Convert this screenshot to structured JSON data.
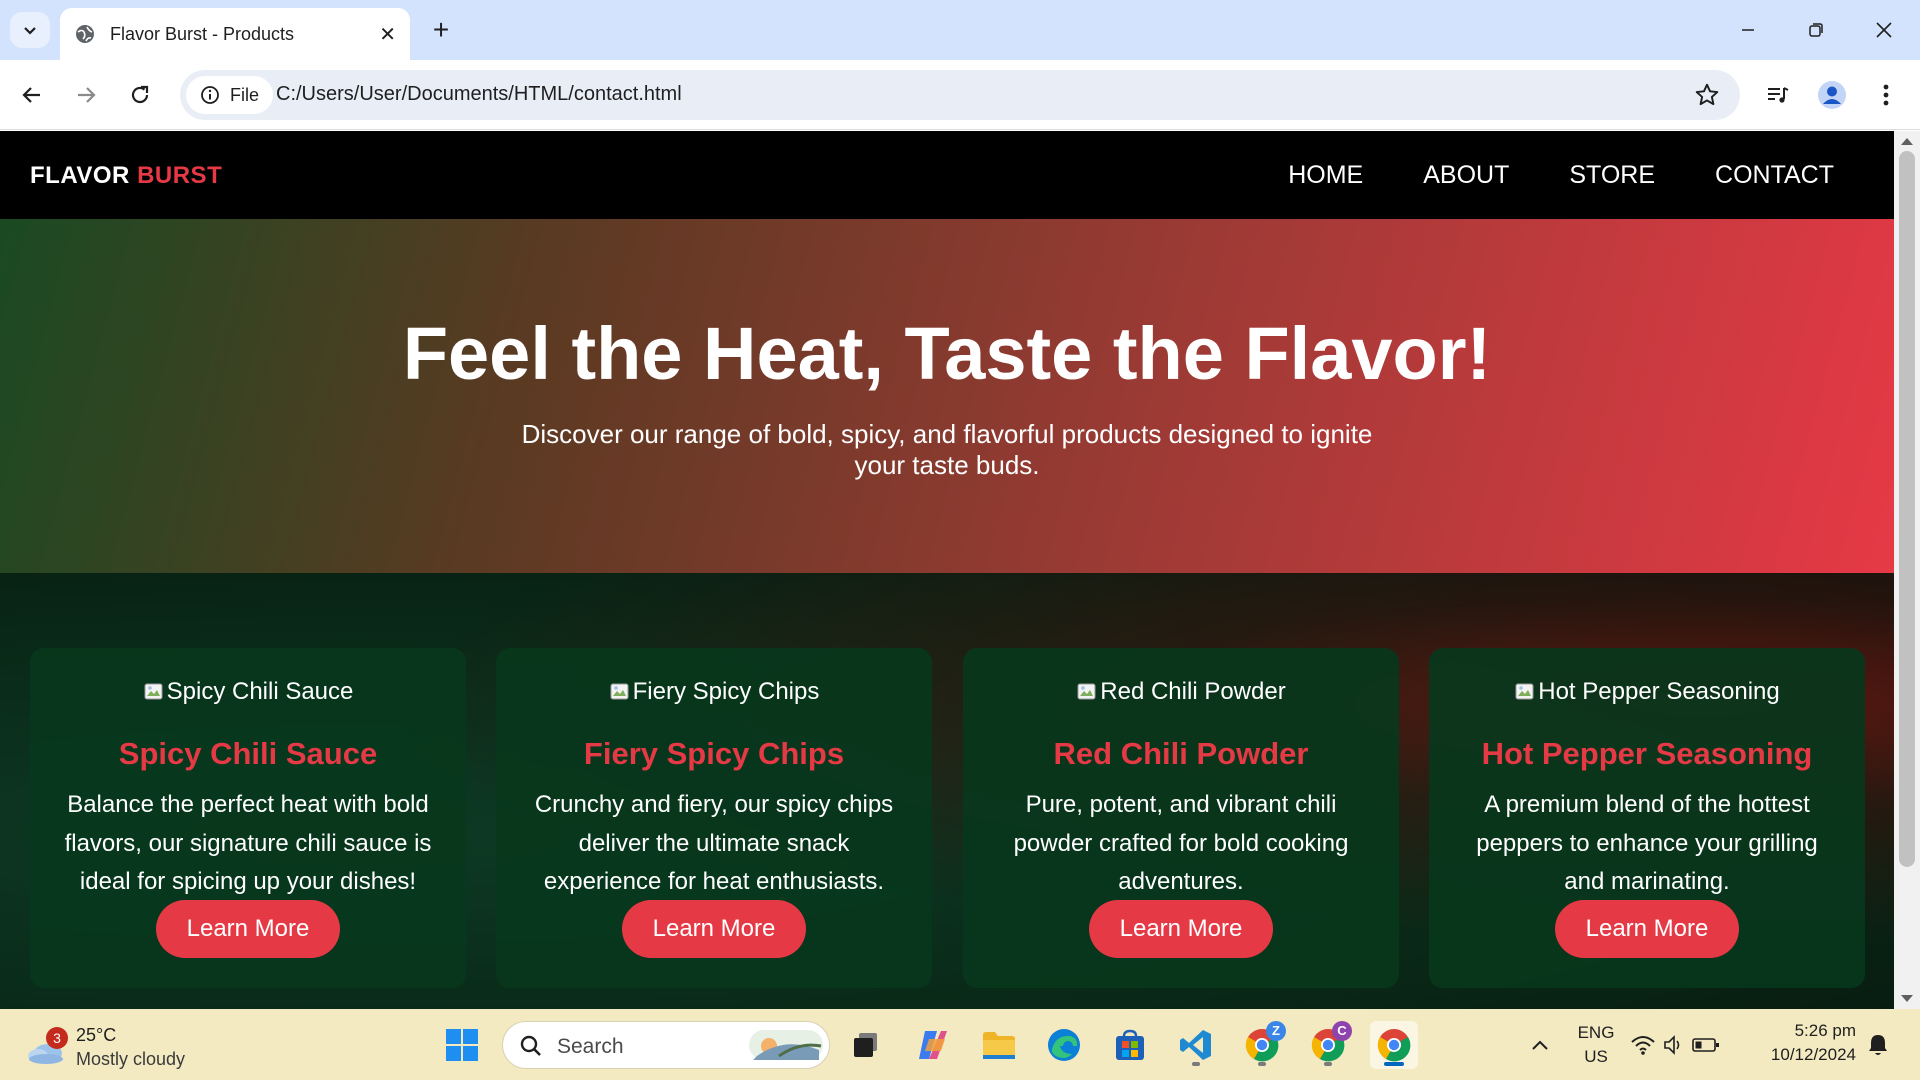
{
  "browser": {
    "tab_title": "Flavor Burst - Products",
    "url_chip": "File",
    "url": "C:/Users/User/Documents/HTML/contact.html",
    "icons": [
      "tab-list-icon",
      "globe-icon",
      "close-icon",
      "plus-icon",
      "minimize-icon",
      "restore-icon",
      "close-window-icon",
      "back-icon",
      "forward-icon",
      "reload-icon",
      "info-icon",
      "star-icon",
      "media-icon",
      "profile-icon",
      "menu-icon"
    ]
  },
  "site": {
    "logo_part1": "FLAVOR",
    "logo_part2": "BURST",
    "nav": [
      "HOME",
      "ABOUT",
      "STORE",
      "CONTACT"
    ],
    "hero": {
      "title": "Feel the Heat, Taste the Flavor!",
      "subtitle": "Discover our range of bold, spicy, and flavorful products designed to ignite your taste buds."
    },
    "products": [
      {
        "image_alt": "Spicy Chili Sauce",
        "name": "Spicy Chili Sauce",
        "description": "Balance the perfect heat with bold flavors, our signature chili sauce is ideal for spicing up your dishes!",
        "button": "Learn More"
      },
      {
        "image_alt": "Fiery Spicy Chips",
        "name": "Fiery Spicy Chips",
        "description": "Crunchy and fiery, our spicy chips deliver the ultimate snack experience for heat enthusiasts.",
        "button": "Learn More"
      },
      {
        "image_alt": "Red Chili Powder",
        "name": "Red Chili Powder",
        "description": "Pure, potent, and vibrant chili powder crafted for bold cooking adventures.",
        "button": "Learn More"
      },
      {
        "image_alt": "Hot Pepper Seasoning",
        "name": "Hot Pepper Seasoning",
        "description": "A premium blend of the hottest peppers to enhance your grilling and marinating.",
        "button": "Learn More"
      }
    ],
    "colors": {
      "accent": "#e63946",
      "nav_bg": "#000000",
      "card_bg": "#08371c"
    }
  },
  "taskbar": {
    "weather_badge": "3",
    "temperature": "25°C",
    "condition": "Mostly cloudy",
    "search_label": "Search",
    "language_line1": "ENG",
    "language_line2": "US",
    "time": "5:26 pm",
    "date": "10/12/2024",
    "chrome_badge_1": "Z",
    "chrome_badge_2": "C",
    "icons": [
      "weather-icon",
      "start-icon",
      "search-icon",
      "task-view-icon",
      "copilot-icon",
      "file-explorer-icon",
      "edge-icon",
      "store-icon",
      "vscode-icon",
      "chrome-icon",
      "chevron-up-icon",
      "wifi-icon",
      "volume-icon",
      "battery-icon",
      "notification-icon"
    ]
  }
}
